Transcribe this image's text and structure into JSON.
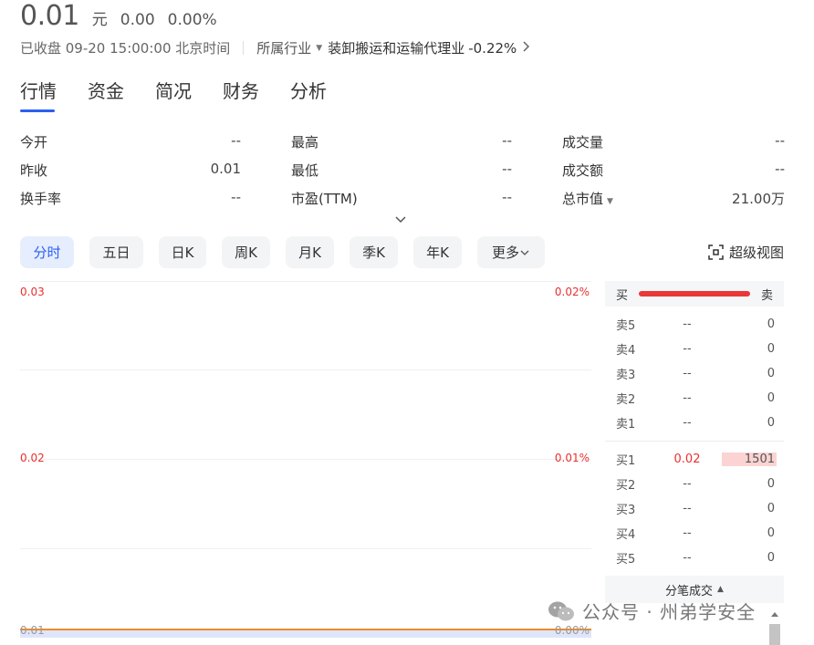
{
  "quote": {
    "price": "0.01",
    "unit": "元",
    "change": "0.00",
    "change_pct": "0.00%"
  },
  "status": {
    "market_status": "已收盘 09-20 15:00:00 北京时间",
    "industry_label": "所属行业",
    "industry_name": "装卸搬运和运输代理业",
    "industry_change": "-0.22%"
  },
  "tabs": [
    {
      "label": "行情",
      "active": true
    },
    {
      "label": "资金"
    },
    {
      "label": "简况"
    },
    {
      "label": "财务"
    },
    {
      "label": "分析"
    }
  ],
  "stats": {
    "open": {
      "label": "今开",
      "value": "--"
    },
    "high": {
      "label": "最高",
      "value": "--"
    },
    "volume": {
      "label": "成交量",
      "value": "--"
    },
    "prev_close": {
      "label": "昨收",
      "value": "0.01"
    },
    "low": {
      "label": "最低",
      "value": "--"
    },
    "amount": {
      "label": "成交额",
      "value": "--"
    },
    "turnover": {
      "label": "换手率",
      "value": "--"
    },
    "pe": {
      "label": "市盈(TTM)",
      "value": "--"
    },
    "market_cap": {
      "label": "总市值",
      "value": "21.00万"
    }
  },
  "periods": [
    {
      "label": "分时",
      "active": true
    },
    {
      "label": "五日"
    },
    {
      "label": "日K"
    },
    {
      "label": "周K"
    },
    {
      "label": "月K"
    },
    {
      "label": "季K"
    },
    {
      "label": "年K"
    },
    {
      "label": "更多"
    }
  ],
  "super_view_label": "超级视图",
  "chart": {
    "y_left": [
      "0.03",
      "0.02",
      "0.01"
    ],
    "y_right": [
      "0.02%",
      "0.01%",
      "0.00%"
    ],
    "line_color": "#f08a2c",
    "up_color": "#e93030"
  },
  "orderbook": {
    "buy_label": "买",
    "sell_label": "卖",
    "asks": [
      {
        "label": "卖5",
        "price": "--",
        "volume": "0"
      },
      {
        "label": "卖4",
        "price": "--",
        "volume": "0"
      },
      {
        "label": "卖3",
        "price": "--",
        "volume": "0"
      },
      {
        "label": "卖2",
        "price": "--",
        "volume": "0"
      },
      {
        "label": "卖1",
        "price": "--",
        "volume": "0"
      }
    ],
    "bids": [
      {
        "label": "买1",
        "price": "0.02",
        "volume": "1501"
      },
      {
        "label": "买2",
        "price": "--",
        "volume": "0"
      },
      {
        "label": "买3",
        "price": "--",
        "volume": "0"
      },
      {
        "label": "买4",
        "price": "--",
        "volume": "0"
      },
      {
        "label": "买5",
        "price": "--",
        "volume": "0"
      }
    ],
    "footer_label": "分笔成交"
  },
  "watermark": "公众号 · 州弟学安全"
}
